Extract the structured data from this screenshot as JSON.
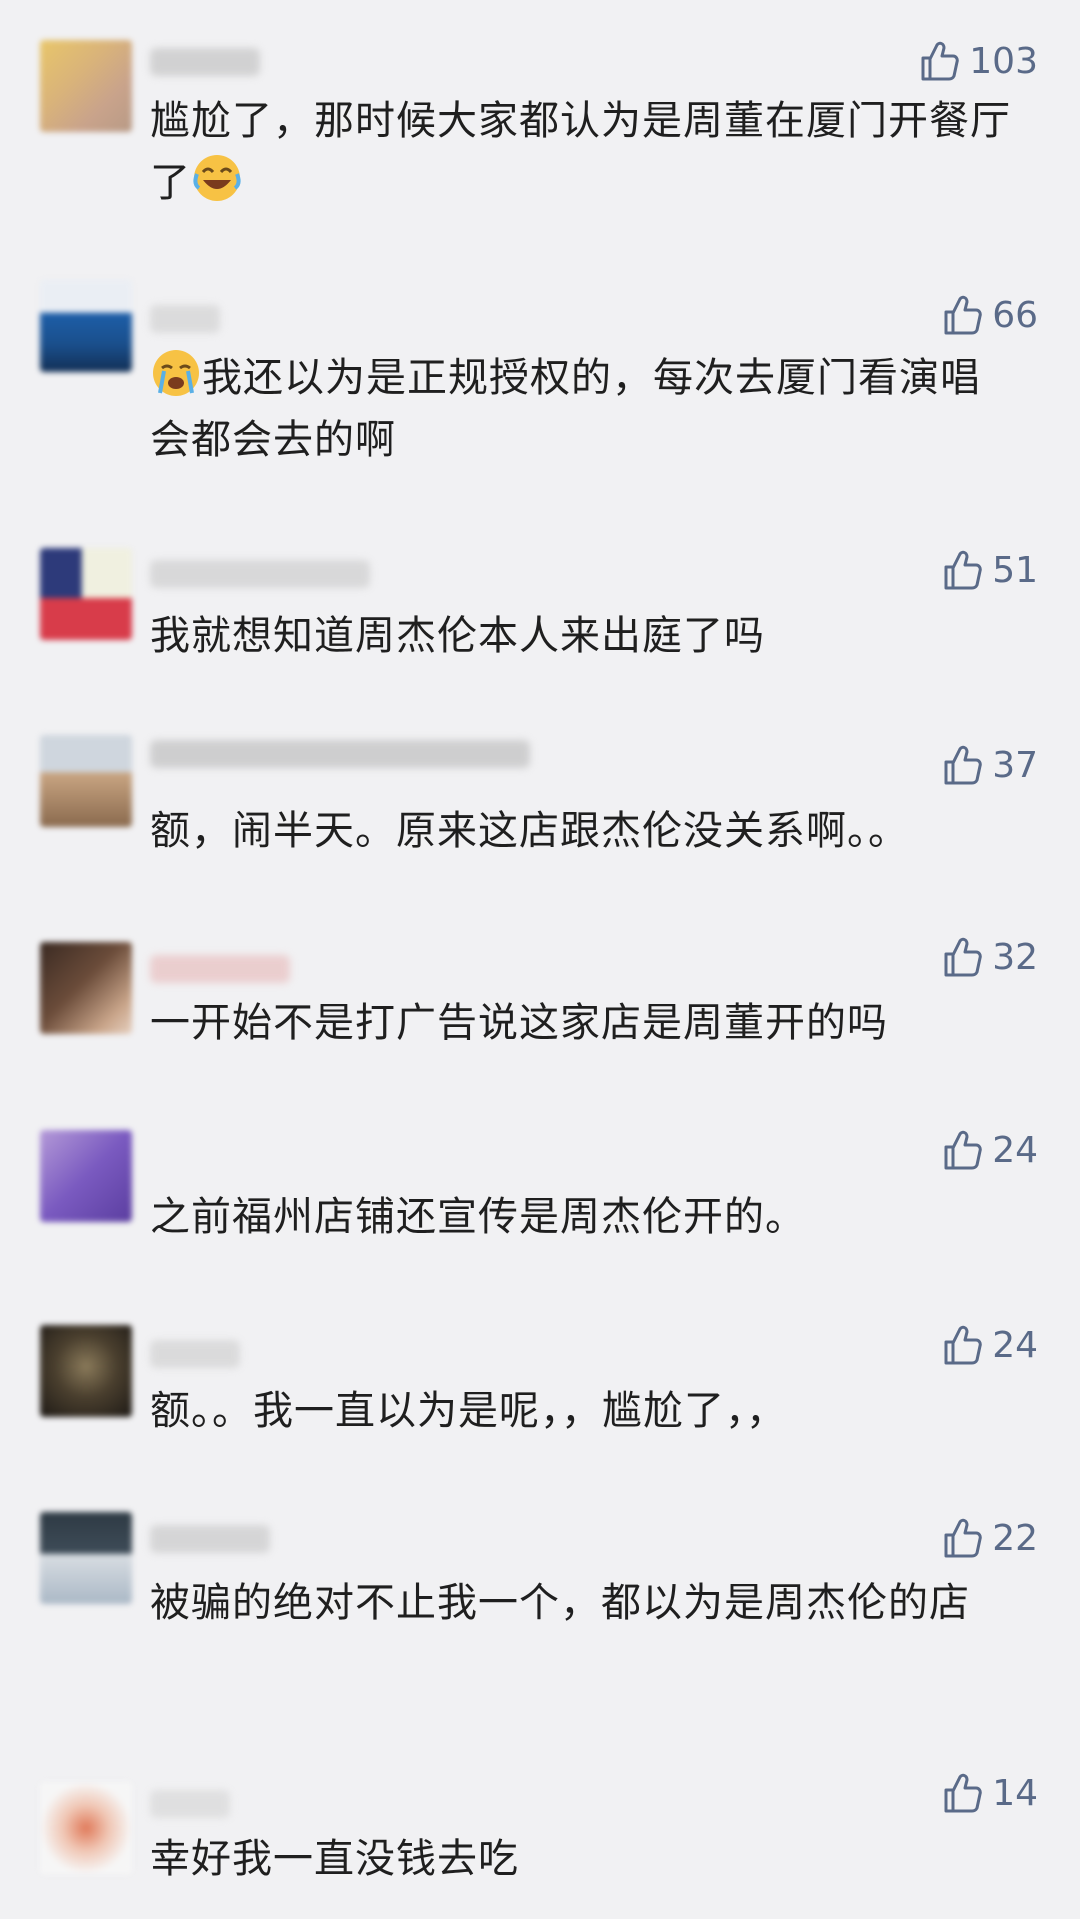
{
  "comments": [
    {
      "like_count": "103",
      "text_before": "尴尬了，那时候大家都认为是周董在厦门开餐厅了",
      "emoji": "laugh-cry-emoji",
      "text_after": ""
    },
    {
      "like_count": "66",
      "text_before": "",
      "emoji": "sob-emoji",
      "text_after": "我还以为是正规授权的，每次去厦门看演唱会都会去的啊"
    },
    {
      "like_count": "51",
      "text": "我就想知道周杰伦本人来出庭了吗"
    },
    {
      "like_count": "37",
      "text": "额，闹半天。原来这店跟杰伦没关系啊。。"
    },
    {
      "like_count": "32",
      "text": "一开始不是打广告说这家店是周董开的吗"
    },
    {
      "like_count": "24",
      "text": "之前福州店铺还宣传是周杰伦开的。"
    },
    {
      "like_count": "24",
      "text": "额。。我一直以为是呢，，尴尬了，，"
    },
    {
      "like_count": "22",
      "text": "被骗的绝对不止我一个，都以为是周杰伦的店"
    },
    {
      "like_count": "14",
      "text": "幸好我一直没钱去吃"
    }
  ],
  "colors": {
    "background": "#f1f1f3",
    "text": "#1f1f1f",
    "like": "#5a6a88"
  },
  "icons": {
    "like": "thumbs-up-outline-icon"
  }
}
